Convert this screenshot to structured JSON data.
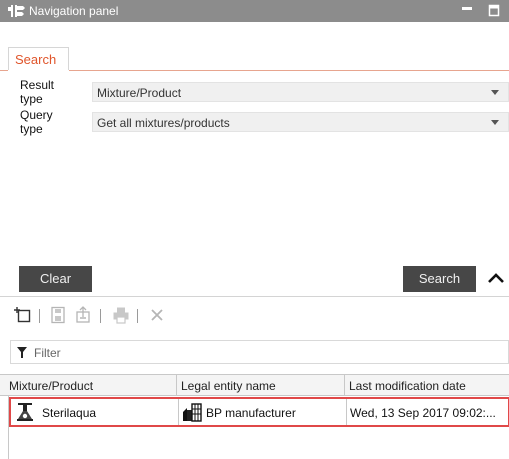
{
  "window": {
    "title": "Navigation panel"
  },
  "tabs": [
    {
      "label": "Search",
      "active": true
    }
  ],
  "form": {
    "result_type": {
      "label": "Result type",
      "value": "Mixture/Product"
    },
    "query_type": {
      "label": "Query type",
      "value": "Get all mixtures/products"
    }
  },
  "buttons": {
    "clear": "Clear",
    "search": "Search"
  },
  "filter": {
    "placeholder": "Filter"
  },
  "table": {
    "columns": [
      "Mixture/Product",
      "Legal entity name",
      "Last modification date"
    ],
    "rows": [
      {
        "product": "Sterilaqua",
        "legal_entity": "BP manufacturer",
        "modified": "Wed, 13 Sep 2017 09:02:..."
      }
    ]
  },
  "colors": {
    "titlebar": "#8c8c8c",
    "accent": "#e0552b",
    "button": "#474747",
    "selection_border": "#e04848"
  },
  "icons": {
    "title": "signpost-icon",
    "toolbar": [
      "new-icon",
      "save-icon",
      "export-icon",
      "print-icon",
      "delete-icon"
    ],
    "filter": "funnel-icon",
    "product": "flask-icon",
    "legal_entity": "factory-icon"
  }
}
